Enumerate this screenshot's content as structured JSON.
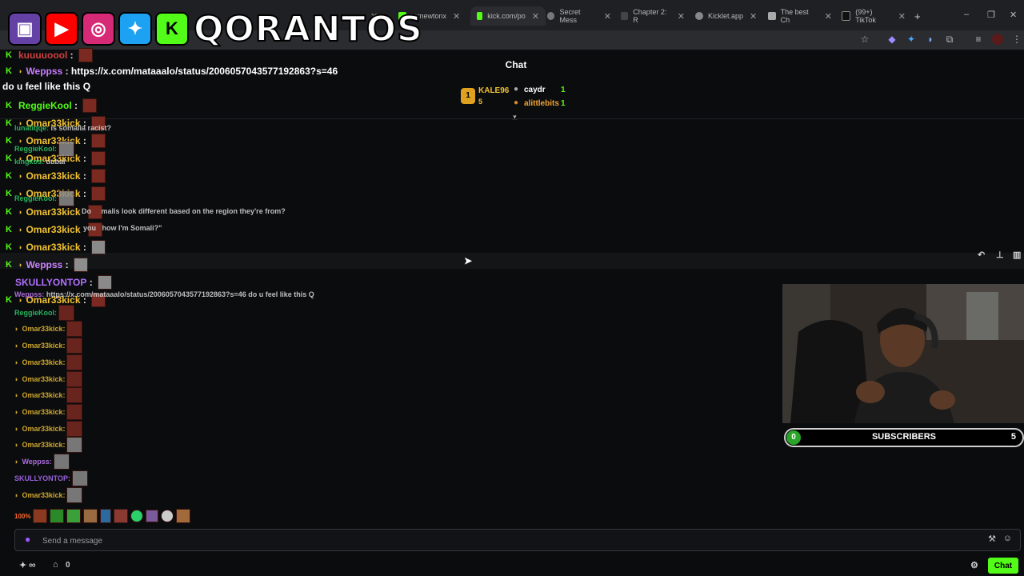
{
  "tabs": [
    {
      "label": "mrnewtonx"
    },
    {
      "label": "kick.com/po"
    },
    {
      "label": "Secret Mess"
    },
    {
      "label": "Chapter 2: R"
    },
    {
      "label": "Kicklet.app"
    },
    {
      "label": "The best Ch"
    },
    {
      "label": "(99+) TikTok"
    }
  ],
  "overlay": {
    "brand": "QORANTOS",
    "k_label": "K"
  },
  "chat": {
    "title": "Chat",
    "placeholder": "Send a message",
    "send_label": "Chat",
    "bottom_count": "0",
    "infinity": "∞"
  },
  "leaderboard": {
    "rank": "1",
    "first": {
      "name": "KALE96",
      "amount": "5"
    },
    "entries": [
      {
        "name": "caydr",
        "amount": "1"
      },
      {
        "name": "alittlebits",
        "amount": "1"
      }
    ]
  },
  "messages": [
    {
      "user": "kuuuuoool",
      "color": "#d04040",
      "text": ""
    },
    {
      "user": "Weppss",
      "color": "#c77dff",
      "text": "https://x.com/mataaalo/status/2006057043577192863?s=46"
    },
    {
      "user": "",
      "color": "#ffffff",
      "text": "do u feel like this Q"
    },
    {
      "user": "ReggieKool",
      "color": "#53fc18",
      "text": ""
    },
    {
      "user": "Omar33kick",
      "color": "#f1c232",
      "text": ""
    },
    {
      "user": "Omar33kick",
      "color": "#f1c232",
      "text": ""
    },
    {
      "user": "Omar33kick",
      "color": "#f1c232",
      "text": ""
    },
    {
      "user": "Omar33kick",
      "color": "#f1c232",
      "text": ""
    },
    {
      "user": "Omar33kick",
      "color": "#f1c232",
      "text": ""
    },
    {
      "user": "Omar33kick",
      "color": "#f1c232",
      "text": ""
    },
    {
      "user": "Omar33kick",
      "color": "#f1c232",
      "text": ""
    },
    {
      "user": "Omar33kick",
      "color": "#f1c232",
      "text": ""
    },
    {
      "user": "Weppss",
      "color": "#c77dff",
      "text": ""
    },
    {
      "user": "SKULLYONTOP",
      "color": "#b070ff",
      "text": ""
    },
    {
      "user": "Omar33kick",
      "color": "#f1c232",
      "text": ""
    }
  ],
  "overlay_chat": [
    {
      "user": "lunatiqqe:",
      "color": "#2bd16a",
      "text": "is somalia racist?"
    },
    {
      "user": "ReggieKool:",
      "color": "#2bd16a",
      "text": ""
    },
    {
      "user": "kingkos:",
      "color": "#2bd16a",
      "text": "dubai"
    },
    {
      "user": "ReggieKool:",
      "color": "#2bd16a",
      "text": ""
    },
    {
      "user": "Do",
      "color": "#dddddd",
      "text": "malis look different based on the region they're from?"
    },
    {
      "user": "you",
      "color": "#dddddd",
      "text": "how I'm Somali?\""
    },
    {
      "user": "Weppss:",
      "color": "#c77dff",
      "text": "https://x.com/mataaalo/status/2006057043577192863?s=46 do u feel like this Q"
    },
    {
      "user": "ReggieKool:",
      "color": "#2bd16a",
      "text": ""
    },
    {
      "user": "Omar33kick:",
      "color": "#f1c232",
      "text": ""
    },
    {
      "user": "Omar33kick:",
      "color": "#f1c232",
      "text": ""
    },
    {
      "user": "Omar33kick:",
      "color": "#f1c232",
      "text": ""
    },
    {
      "user": "Omar33kick:",
      "color": "#f1c232",
      "text": ""
    },
    {
      "user": "Omar33kick:",
      "color": "#f1c232",
      "text": ""
    },
    {
      "user": "Omar33kick:",
      "color": "#f1c232",
      "text": ""
    },
    {
      "user": "Omar33kick:",
      "color": "#f1c232",
      "text": ""
    },
    {
      "user": "Omar33kick:",
      "color": "#f1c232",
      "text": ""
    },
    {
      "user": "Weppss:",
      "color": "#c77dff",
      "text": ""
    },
    {
      "user": "SKULLYONTOP:",
      "color": "#b070ff",
      "text": ""
    },
    {
      "user": "Omar33kick:",
      "color": "#f1c232",
      "text": ""
    }
  ],
  "subs": {
    "label": "SUBSCRIBERS",
    "current": "0",
    "goal": "5"
  },
  "colors": {
    "kick_green": "#53fc18",
    "bg": "#0b0c0e"
  }
}
